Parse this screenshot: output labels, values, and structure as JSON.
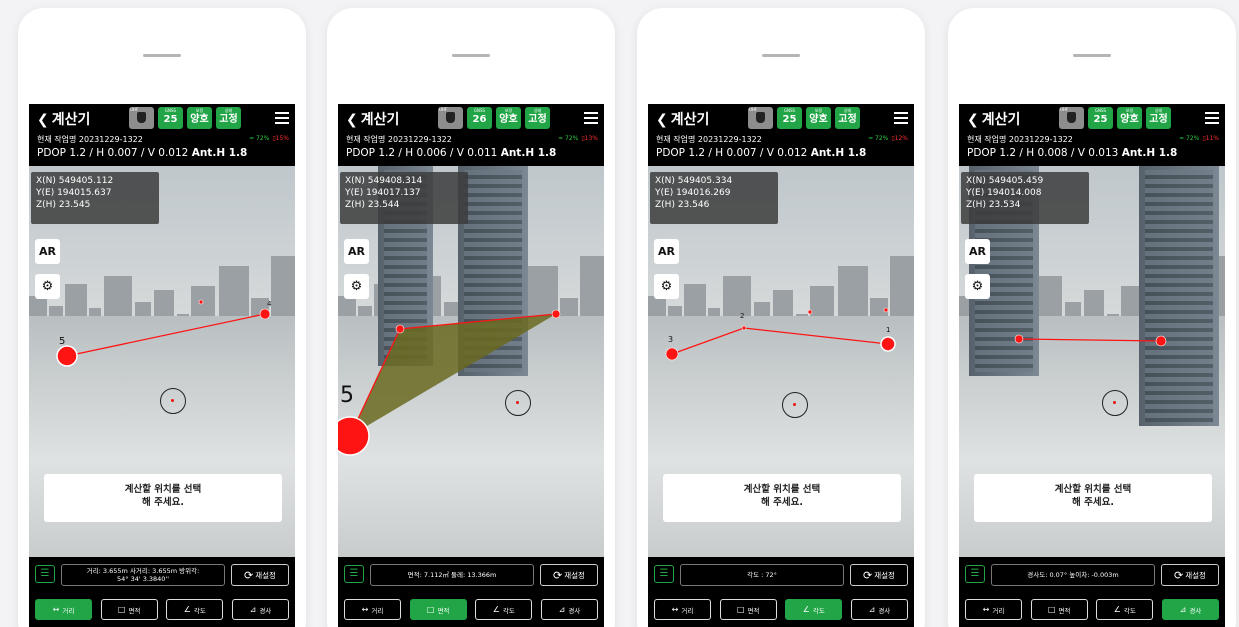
{
  "colors": {
    "accent_green": "#21a547",
    "point_red": "#ff1414",
    "area_fill": "#6a6a20"
  },
  "shared": {
    "back_label": "계산기",
    "ant_label": "UHF",
    "sat_title": "GNSS",
    "sat_label_2": "보정",
    "status_2": "양호",
    "sat_label_3": "상태",
    "status_3": "고정",
    "ar_label": "AR",
    "reset_label": "재설정",
    "tabs": [
      "거리",
      "면적",
      "각도",
      "경사"
    ],
    "prompt_line1": "계산할 위치를 선택",
    "prompt_line2": "해 주세요."
  },
  "screens": [
    {
      "sat_count": "25",
      "job": "현재 작업명 20231229-1322",
      "wifi": "72%",
      "battery": "15%",
      "pdop_text": "PDOP 1.2 / H 0.007 / V 0.012",
      "anth_text": "Ant.H 1.8",
      "coord_n": "X(N) 549405.112",
      "coord_e": "Y(E) 194015.637",
      "coord_h": "Z(H) 23.545",
      "measure_line1": "거리: 3.655m 사거리: 3.655m 방위각:",
      "measure_line2": "54° 34' 3.3840''",
      "active_tab": "거리",
      "show_prompt": true,
      "point_labels": [
        "5",
        "4"
      ]
    },
    {
      "sat_count": "26",
      "job": "현재 작업명 20231229-1322",
      "wifi": "72%",
      "battery": "13%",
      "pdop_text": "PDOP 1.2 / H 0.006 / V 0.011",
      "anth_text": "Ant.H 1.8",
      "coord_n": "X(N) 549408.314",
      "coord_e": "Y(E) 194017.137",
      "coord_h": "Z(H) 23.544",
      "measure_line1": "면적: 7.112㎡ 둘레: 13.366m",
      "measure_line2": "",
      "active_tab": "면적",
      "show_prompt": false,
      "point_labels": [
        "5"
      ]
    },
    {
      "sat_count": "25",
      "job": "현재 작업명 20231229-1322",
      "wifi": "72%",
      "battery": "12%",
      "pdop_text": "PDOP 1.2 / H 0.007 / V 0.012",
      "anth_text": "Ant.H 1.8",
      "coord_n": "X(N) 549405.334",
      "coord_e": "Y(E) 194016.269",
      "coord_h": "Z(H) 23.546",
      "measure_line1": "각도 : 72°",
      "measure_line2": "",
      "active_tab": "각도",
      "show_prompt": true,
      "point_labels": [
        "3",
        "2",
        "1"
      ]
    },
    {
      "sat_count": "25",
      "job": "현재 작업명 20231229-1322",
      "wifi": "72%",
      "battery": "11%",
      "pdop_text": "PDOP 1.2 / H 0.008 / V 0.013",
      "anth_text": "Ant.H 1.8",
      "coord_n": "X(N) 549405.459",
      "coord_e": "Y(E) 194014.008",
      "coord_h": "Z(H) 23.534",
      "measure_line1": "경사도: 0.07° 높이차: -0.003m",
      "measure_line2": "",
      "active_tab": "경사",
      "show_prompt": true,
      "point_labels": []
    }
  ]
}
